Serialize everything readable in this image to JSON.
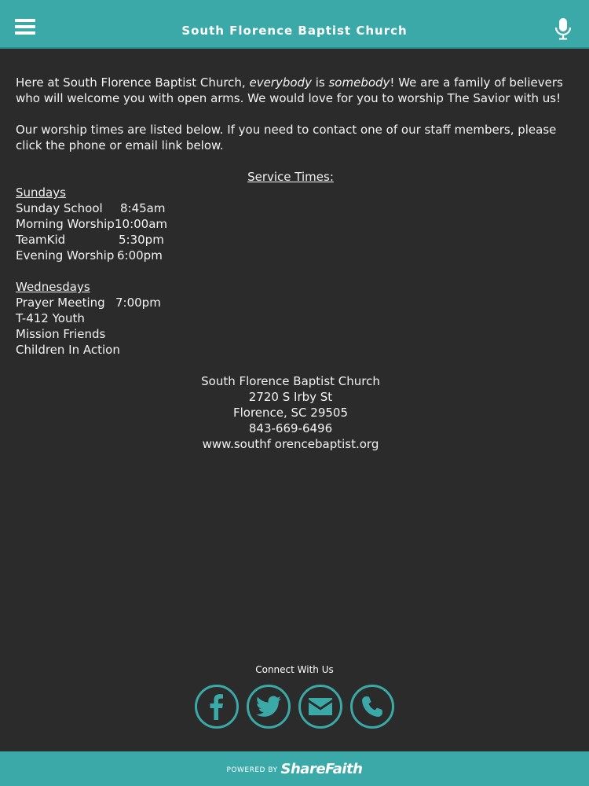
{
  "header": {
    "title": "South Florence Baptist Church",
    "menu_icon": "hamburger-menu-icon",
    "mic_icon": "microphone-icon"
  },
  "intro": {
    "part1": " Here at South Florence Baptist Church, ",
    "em1": "everybody",
    "part2": " is ",
    "em2": "somebody",
    "part3": "! We are a family of believers who will welcome you with open arms. We would love for you to worship The Savior with us!"
  },
  "contact_text": "Our worship times are listed below. If you need to contact one of our staff members, please click the phone or email link below.",
  "service_times": {
    "title": "Service Times:",
    "sundays": {
      "heading": "Sundays",
      "items": [
        {
          "name": "Sunday School",
          "time": "8:45am"
        },
        {
          "name": "Morning Worship",
          "time": "10:00am"
        },
        {
          "name": "TeamKid",
          "time": "5:30pm"
        },
        {
          "name": "Evening Worship",
          "time": "6:00pm"
        }
      ]
    },
    "wednesdays": {
      "heading": "Wednesdays",
      "items": [
        {
          "name": "Prayer Meeting",
          "time": "7:00pm"
        },
        {
          "name": "T-412 Youth",
          "time": ""
        },
        {
          "name": "Mission Friends",
          "time": ""
        },
        {
          "name": "Children In Action",
          "time": ""
        }
      ]
    }
  },
  "address": {
    "name": "South Florence Baptist Church",
    "street": "2720 S Irby St",
    "city": "Florence, SC 29505",
    "phone": "843-669-6496",
    "website": "www.southf orencebaptist.org"
  },
  "connect": {
    "title": "Connect With Us",
    "icons": [
      "facebook-icon",
      "twitter-icon",
      "email-icon",
      "phone-icon"
    ]
  },
  "footer": {
    "powered": "POWERED BY",
    "brand": "ShareFaith"
  },
  "colors": {
    "accent": "#3aa9a8",
    "background": "#2b2b2b",
    "text": "#f3f3f3"
  }
}
